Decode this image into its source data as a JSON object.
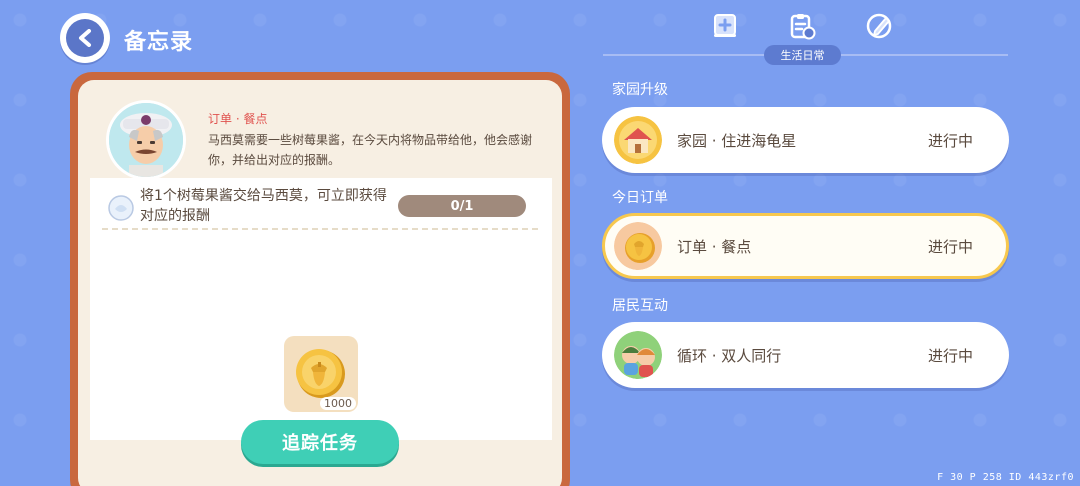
{
  "header": {
    "title": "备忘录",
    "back_icon": "chevron-left-icon"
  },
  "task_detail": {
    "type_label": "订单 · 餐点",
    "description": "马西莫需要一些树莓果酱，在今天内将物品带给他，他会感谢你，并给出对应的报酬。",
    "goal_text": "将1个树莓果酱交给马西莫，可立即获得对应的报酬",
    "progress_text": "0/1",
    "progress": 0,
    "reward_amount": "1000",
    "track_button_label": "追踪任务",
    "colors": {
      "panel_border": "#c9683e",
      "type_label": "#e0534f",
      "track_button": "#3fcfb6"
    }
  },
  "tabs": {
    "icons": [
      "home-plus-icon",
      "clipboard-check-icon",
      "pencil-edit-icon"
    ],
    "selected_label": "生活日常"
  },
  "sections": [
    {
      "title": "家园升级",
      "quest": {
        "name": "家园 · 住进海龟星",
        "status": "进行中",
        "icon": "house-icon",
        "selected": false
      }
    },
    {
      "title": "今日订单",
      "quest": {
        "name": "订单 · 餐点",
        "status": "进行中",
        "icon": "coin-icon",
        "selected": true
      }
    },
    {
      "title": "居民互动",
      "quest": {
        "name": "循环 · 双人同行",
        "status": "进行中",
        "icon": "two-people-icon",
        "selected": false
      }
    }
  ],
  "debug": {
    "text": "F 30  P 258  ID 443zrf0"
  }
}
